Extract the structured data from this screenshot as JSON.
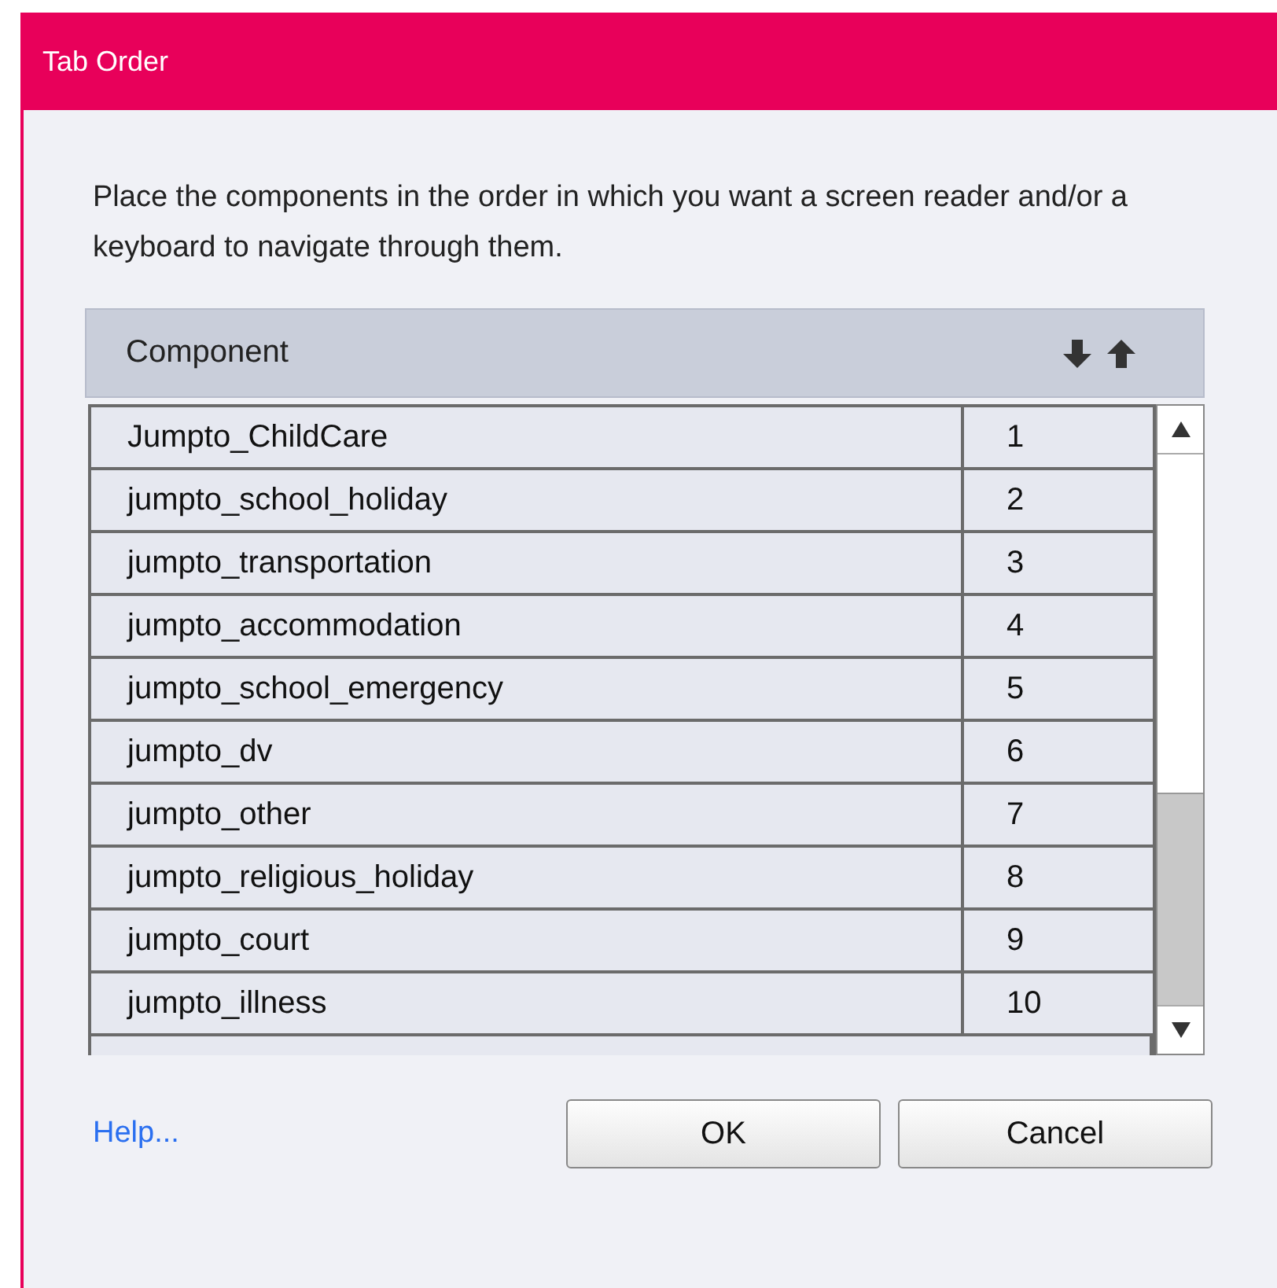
{
  "window": {
    "title": "Tab Order"
  },
  "instructions": "Place the components in the order in which you want a  screen reader and/or a keyboard to navigate through them.",
  "table": {
    "columns": [
      "Component"
    ],
    "rows": [
      {
        "name": "Jumpto_ChildCare",
        "order": "1"
      },
      {
        "name": "jumpto_school_holiday",
        "order": "2"
      },
      {
        "name": "jumpto_transportation",
        "order": "3"
      },
      {
        "name": "jumpto_accommodation",
        "order": "4"
      },
      {
        "name": "jumpto_school_emergency",
        "order": "5"
      },
      {
        "name": "jumpto_dv",
        "order": "6"
      },
      {
        "name": "jumpto_other",
        "order": "7"
      },
      {
        "name": "jumpto_religious_holiday",
        "order": "8"
      },
      {
        "name": "jumpto_court",
        "order": "9"
      },
      {
        "name": "jumpto_illness",
        "order": "10"
      }
    ]
  },
  "help_link": "Help...",
  "buttons": [
    "OK",
    "Cancel"
  ]
}
